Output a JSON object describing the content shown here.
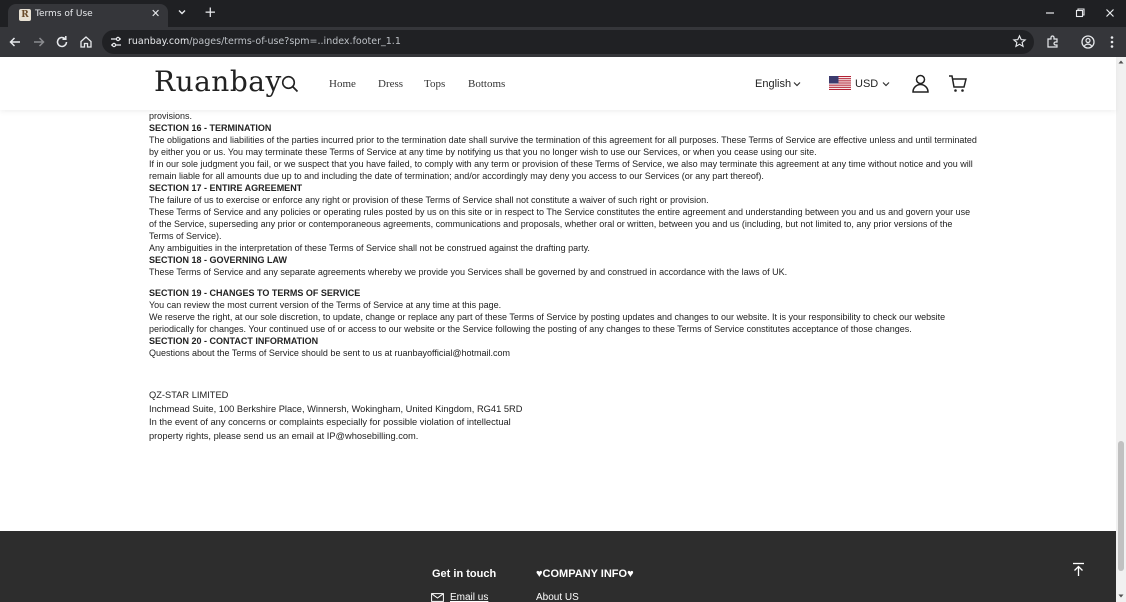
{
  "browser": {
    "tab_title": "Terms of Use",
    "tab_favicon_letter": "R",
    "tab_close": "✕",
    "new_tab": "+",
    "url_host": "ruanbay.com",
    "url_path": "/pages/terms-of-use?spm=..index.footer_1.1"
  },
  "header": {
    "logo": "Ruanbay",
    "nav": [
      "Home",
      "Dress",
      "Tops",
      "Bottoms"
    ],
    "language": "English",
    "currency": "USD"
  },
  "content": {
    "lead": "provisions.",
    "s16_title": "SECTION 16 - TERMINATION",
    "s16_p1": "The obligations and liabilities of the parties incurred prior to the termination date shall survive the termination of this agreement for all purposes. These Terms of Service are effective unless and until terminated by either you or us. You may terminate these Terms of Service at any time by notifying us that you no longer wish to use our Services, or when you cease using our site.",
    "s16_p2": "If in our sole judgment you fail, or we suspect that you have failed, to comply with any term or provision of these Terms of Service, we also may terminate this agreement at any time without notice and you will remain liable for all amounts due up to and including the date of termination; and/or accordingly may deny you access to our Services (or any part thereof).",
    "s17_title": "SECTION 17 - ENTIRE AGREEMENT",
    "s17_p1": "The failure of us to exercise or enforce any right or provision of these Terms of Service shall not constitute a waiver of such right or provision.",
    "s17_p2": "These Terms of Service and any policies or operating rules posted by us on this site or in respect to The Service constitutes the entire agreement and understanding between you and us and govern your use of the Service, superseding any prior or contemporaneous agreements, communications and proposals, whether oral or written, between you and us (including, but not limited to, any prior versions of the Terms of Service).",
    "s17_p3": "Any ambiguities in the interpretation of these Terms of Service shall not be construed against the drafting party.",
    "s18_title": "SECTION 18 - GOVERNING LAW",
    "s18_p1": "These Terms of Service and any separate agreements whereby we provide you Services shall be governed by and construed in accordance with the laws of UK.",
    "s19_title": "SECTION 19 - CHANGES TO TERMS OF SERVICE",
    "s19_p1": "You can review the most current version of the Terms of Service at any time at this page.",
    "s19_p2": "We reserve the right, at our sole discretion, to update, change or replace any part of these Terms of Service by posting updates and changes to our website. It is your responsibility to check our website periodically for changes. Your continued use of or access to our website or the Service following the posting of any changes to these Terms of Service constitutes acceptance of those changes.",
    "s20_title": "SECTION 20 - CONTACT INFORMATION",
    "s20_p1": "Questions about the Terms of Service should be sent to us at ruanbayofficial@hotmail.com",
    "company_name": "QZ-STAR LIMITED",
    "company_address": "Inchmead Suite, 100 Berkshire Place, Winnersh, Wokingham, United Kingdom, RG41 5RD",
    "company_note_1": "In the event of any concerns or complaints especially for possible violation of intellectual",
    "company_note_2": "property rights, please send us an email at IP@whosebilling.com."
  },
  "footer": {
    "get_in_touch": "Get in touch",
    "company_info": "♥COMPANY INFO♥",
    "email_link": "Email us",
    "about_link": "About US"
  },
  "colors": {
    "chrome_dark": "#1f2023",
    "chrome_toolbar": "#35363a",
    "footer_bg": "#2d2d2d",
    "text": "#222222"
  }
}
